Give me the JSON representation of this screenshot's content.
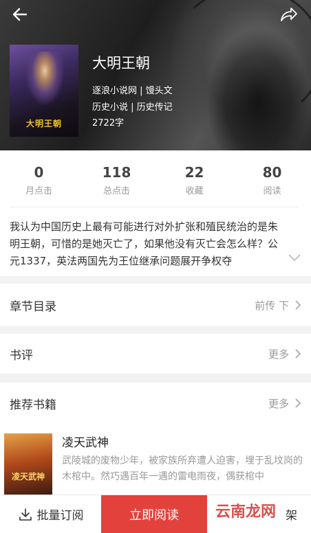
{
  "header": {
    "back_icon": "back-arrow-icon",
    "share_icon": "share-icon"
  },
  "book": {
    "cover_title": "大明王朝",
    "title": "大明王朝",
    "source_author": "逐浪小说网 | 馒头文",
    "category": "历史小说 | 历史传记",
    "word_count": "2722字"
  },
  "stats": [
    {
      "value": "0",
      "label": "月点击"
    },
    {
      "value": "118",
      "label": "总点击"
    },
    {
      "value": "22",
      "label": "收藏"
    },
    {
      "value": "80",
      "label": "阅读"
    }
  ],
  "description": "我认为中国历史上最有可能进行对外扩张和殖民统治的是朱明王朝，可惜的是她灭亡了，如果他没有灭亡会怎么样？公元1337，英法两国先为王位继承问题展开争权夺",
  "chapters": {
    "title": "章节目录",
    "action": "前传 下"
  },
  "reviews": {
    "title": "书评",
    "action": "更多"
  },
  "recommend": {
    "title": "推荐书籍",
    "action": "更多",
    "book": {
      "cover_title": "凌天武神",
      "title": "凌天武神",
      "desc": "武陵城的废物少年，被家族所弃遭人迫害，埋于乱坟岗的木棺中。然巧遇百年一遇的雷电雨夜，偶获棺中"
    }
  },
  "bottom_bar": {
    "subscribe": "批量订阅",
    "read_now": "立即阅读",
    "shelf": "架",
    "watermark": "云南龙网"
  },
  "colors": {
    "accent": "#e3413b"
  }
}
